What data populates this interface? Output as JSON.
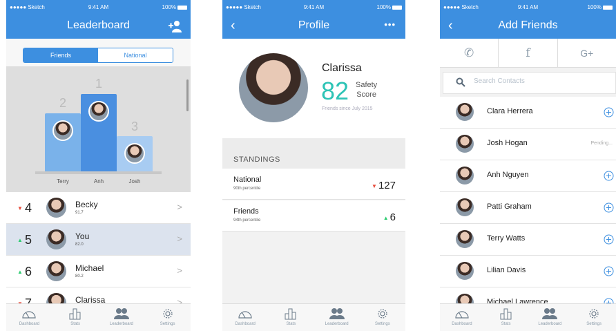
{
  "status_bar": {
    "carrier": "●●●●● Sketch",
    "time": "9:41 AM",
    "battery": "100%"
  },
  "leaderboard": {
    "title": "Leaderboard",
    "segments": [
      "Friends",
      "National"
    ],
    "podium": [
      {
        "rank": "2",
        "name": "Terry"
      },
      {
        "rank": "1",
        "name": "Anh"
      },
      {
        "rank": "3",
        "name": "Josh"
      }
    ],
    "rows": [
      {
        "trend": "down",
        "arrow": "▼",
        "rank": "4",
        "name": "Becky",
        "score": "91.7"
      },
      {
        "trend": "up",
        "arrow": "▲",
        "rank": "5",
        "name": "You",
        "score": "82.0"
      },
      {
        "trend": "up",
        "arrow": "▲",
        "rank": "6",
        "name": "Michael",
        "score": "80.2"
      },
      {
        "trend": "down",
        "arrow": "▼",
        "rank": "7",
        "name": "Clarissa",
        "score": ""
      }
    ],
    "chevron": ">"
  },
  "profile": {
    "title": "Profile",
    "back": "‹",
    "more": "•••",
    "name": "Clarissa",
    "score": "82",
    "score_label_1": "Safety",
    "score_label_2": "Score",
    "since": "Friends since July 2015",
    "standings_title": "STANDINGS",
    "standings": [
      {
        "label": "National",
        "percentile": "90th percentile",
        "trend": "down",
        "arrow": "▼",
        "value": "127"
      },
      {
        "label": "Friends",
        "percentile": "94th percentile",
        "trend": "up",
        "arrow": "▲",
        "value": "6"
      }
    ]
  },
  "add_friends": {
    "title": "Add Friends",
    "back": "‹",
    "social": [
      {
        "icon": "phone-icon",
        "glyph": "✆"
      },
      {
        "icon": "facebook-icon",
        "glyph": "f"
      },
      {
        "icon": "google-plus-icon",
        "glyph": "G+"
      }
    ],
    "search_placeholder": "Search Contacts",
    "contacts": [
      {
        "name": "Clara Herrera",
        "status": "add"
      },
      {
        "name": "Josh Hogan",
        "status": "Pending..."
      },
      {
        "name": "Anh Nguyen",
        "status": "add"
      },
      {
        "name": "Patti Graham",
        "status": "add"
      },
      {
        "name": "Terry Watts",
        "status": "add"
      },
      {
        "name": "Lilian Davis",
        "status": "add"
      },
      {
        "name": "Michael Lawrence",
        "status": "add"
      }
    ]
  },
  "tabbar": [
    "Dashboard",
    "Stats",
    "Leaderboard",
    "Settings"
  ],
  "colors": {
    "primary": "#3d8fe0",
    "score_teal": "#2ec4b6",
    "down_red": "#e74c3c",
    "up_green": "#2ecc71",
    "selected_row": "#dce3ee"
  }
}
